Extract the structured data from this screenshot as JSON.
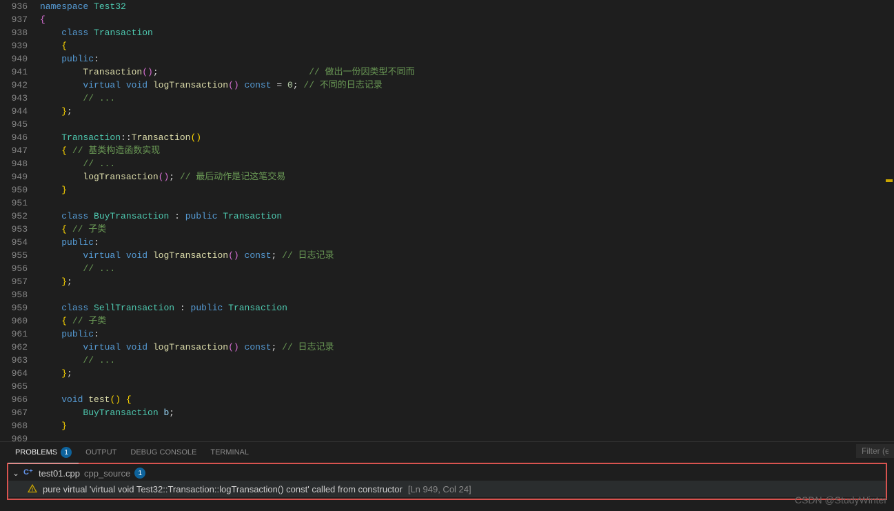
{
  "editor": {
    "startLine": 936,
    "lines": [
      {
        "n": 936,
        "html": "<span class='kw'>namespace</span> <span class='cls'>Test32</span>"
      },
      {
        "n": 937,
        "html": "<span class='brace'>{</span>"
      },
      {
        "n": 938,
        "html": "    <span class='kw'>class</span> <span class='cls'>Transaction</span>"
      },
      {
        "n": 939,
        "html": "    <span class='brace2'>{</span>"
      },
      {
        "n": 940,
        "html": "    <span class='kw'>public</span><span class='punc'>:</span>"
      },
      {
        "n": 941,
        "html": "        <span class='fn'>Transaction</span><span class='brace'>()</span><span class='punc'>;</span>                            <span class='comment'>// 做出一份因类型不同而</span>"
      },
      {
        "n": 942,
        "html": "        <span class='kw'>virtual</span> <span class='kw'>void</span> <span class='fn'>logTransaction</span><span class='brace'>()</span> <span class='kw'>const</span> <span class='punc'>=</span> <span class='num'>0</span><span class='punc'>;</span> <span class='comment'>// 不同的日志记录</span>"
      },
      {
        "n": 943,
        "html": "        <span class='comment'>// ...</span>"
      },
      {
        "n": 944,
        "html": "    <span class='brace2'>}</span><span class='punc'>;</span>"
      },
      {
        "n": 945,
        "html": ""
      },
      {
        "n": 946,
        "html": "    <span class='cls'>Transaction</span><span class='punc'>::</span><span class='fn'>Transaction</span><span class='brace2'>()</span>"
      },
      {
        "n": 947,
        "html": "    <span class='brace2'>{</span> <span class='comment'>// 基类构造函数实现</span>"
      },
      {
        "n": 948,
        "html": "        <span class='comment'>// ...</span>"
      },
      {
        "n": 949,
        "html": "        <span class='fn'>logTransaction</span><span class='brace'>()</span><span class='punc'>;</span> <span class='comment'>// 最后动作是记这笔交易</span>"
      },
      {
        "n": 950,
        "html": "    <span class='brace2'>}</span>"
      },
      {
        "n": 951,
        "html": ""
      },
      {
        "n": 952,
        "html": "    <span class='kw'>class</span> <span class='cls'>BuyTransaction</span> <span class='punc'>:</span> <span class='kw'>public</span> <span class='cls'>Transaction</span>"
      },
      {
        "n": 953,
        "html": "    <span class='brace2'>{</span> <span class='comment'>// 子类</span>"
      },
      {
        "n": 954,
        "html": "    <span class='kw'>public</span><span class='punc'>:</span>"
      },
      {
        "n": 955,
        "html": "        <span class='kw'>virtual</span> <span class='kw'>void</span> <span class='fn'>logTransaction</span><span class='brace'>()</span> <span class='kw'>const</span><span class='punc'>;</span> <span class='comment'>// 日志记录</span>"
      },
      {
        "n": 956,
        "html": "        <span class='comment'>// ...</span>"
      },
      {
        "n": 957,
        "html": "    <span class='brace2'>}</span><span class='punc'>;</span>"
      },
      {
        "n": 958,
        "html": ""
      },
      {
        "n": 959,
        "html": "    <span class='kw'>class</span> <span class='cls'>SellTransaction</span> <span class='punc'>:</span> <span class='kw'>public</span> <span class='cls'>Transaction</span>"
      },
      {
        "n": 960,
        "html": "    <span class='brace2'>{</span> <span class='comment'>// 子类</span>"
      },
      {
        "n": 961,
        "html": "    <span class='kw'>public</span><span class='punc'>:</span>"
      },
      {
        "n": 962,
        "html": "        <span class='kw'>virtual</span> <span class='kw'>void</span> <span class='fn'>logTransaction</span><span class='brace'>()</span> <span class='kw'>const</span><span class='punc'>;</span> <span class='comment'>// 日志记录</span>"
      },
      {
        "n": 963,
        "html": "        <span class='comment'>// ...</span>"
      },
      {
        "n": 964,
        "html": "    <span class='brace2'>}</span><span class='punc'>;</span>"
      },
      {
        "n": 965,
        "html": ""
      },
      {
        "n": 966,
        "html": "    <span class='kw'>void</span> <span class='fn'>test</span><span class='brace2'>()</span> <span class='brace2'>{</span>"
      },
      {
        "n": 967,
        "html": "        <span class='cls'>BuyTransaction</span> <span class='var'>b</span><span class='punc'>;</span>"
      },
      {
        "n": 968,
        "html": "    <span class='brace2'>}</span>"
      },
      {
        "n": 969,
        "html": ""
      }
    ]
  },
  "panel": {
    "tabs": {
      "problems": "PROBLEMS",
      "problemsCount": "1",
      "output": "OUTPUT",
      "debugConsole": "DEBUG CONSOLE",
      "terminal": "TERMINAL"
    },
    "filterPlaceholder": "Filter (e.g."
  },
  "problems": {
    "file": "test01.cpp",
    "folder": "cpp_source",
    "fileCount": "1",
    "message": "pure virtual 'virtual void Test32::Transaction::logTransaction() const' called from constructor",
    "location": "[Ln 949, Col 24]"
  },
  "watermark": "CSDN @StudyWinter"
}
